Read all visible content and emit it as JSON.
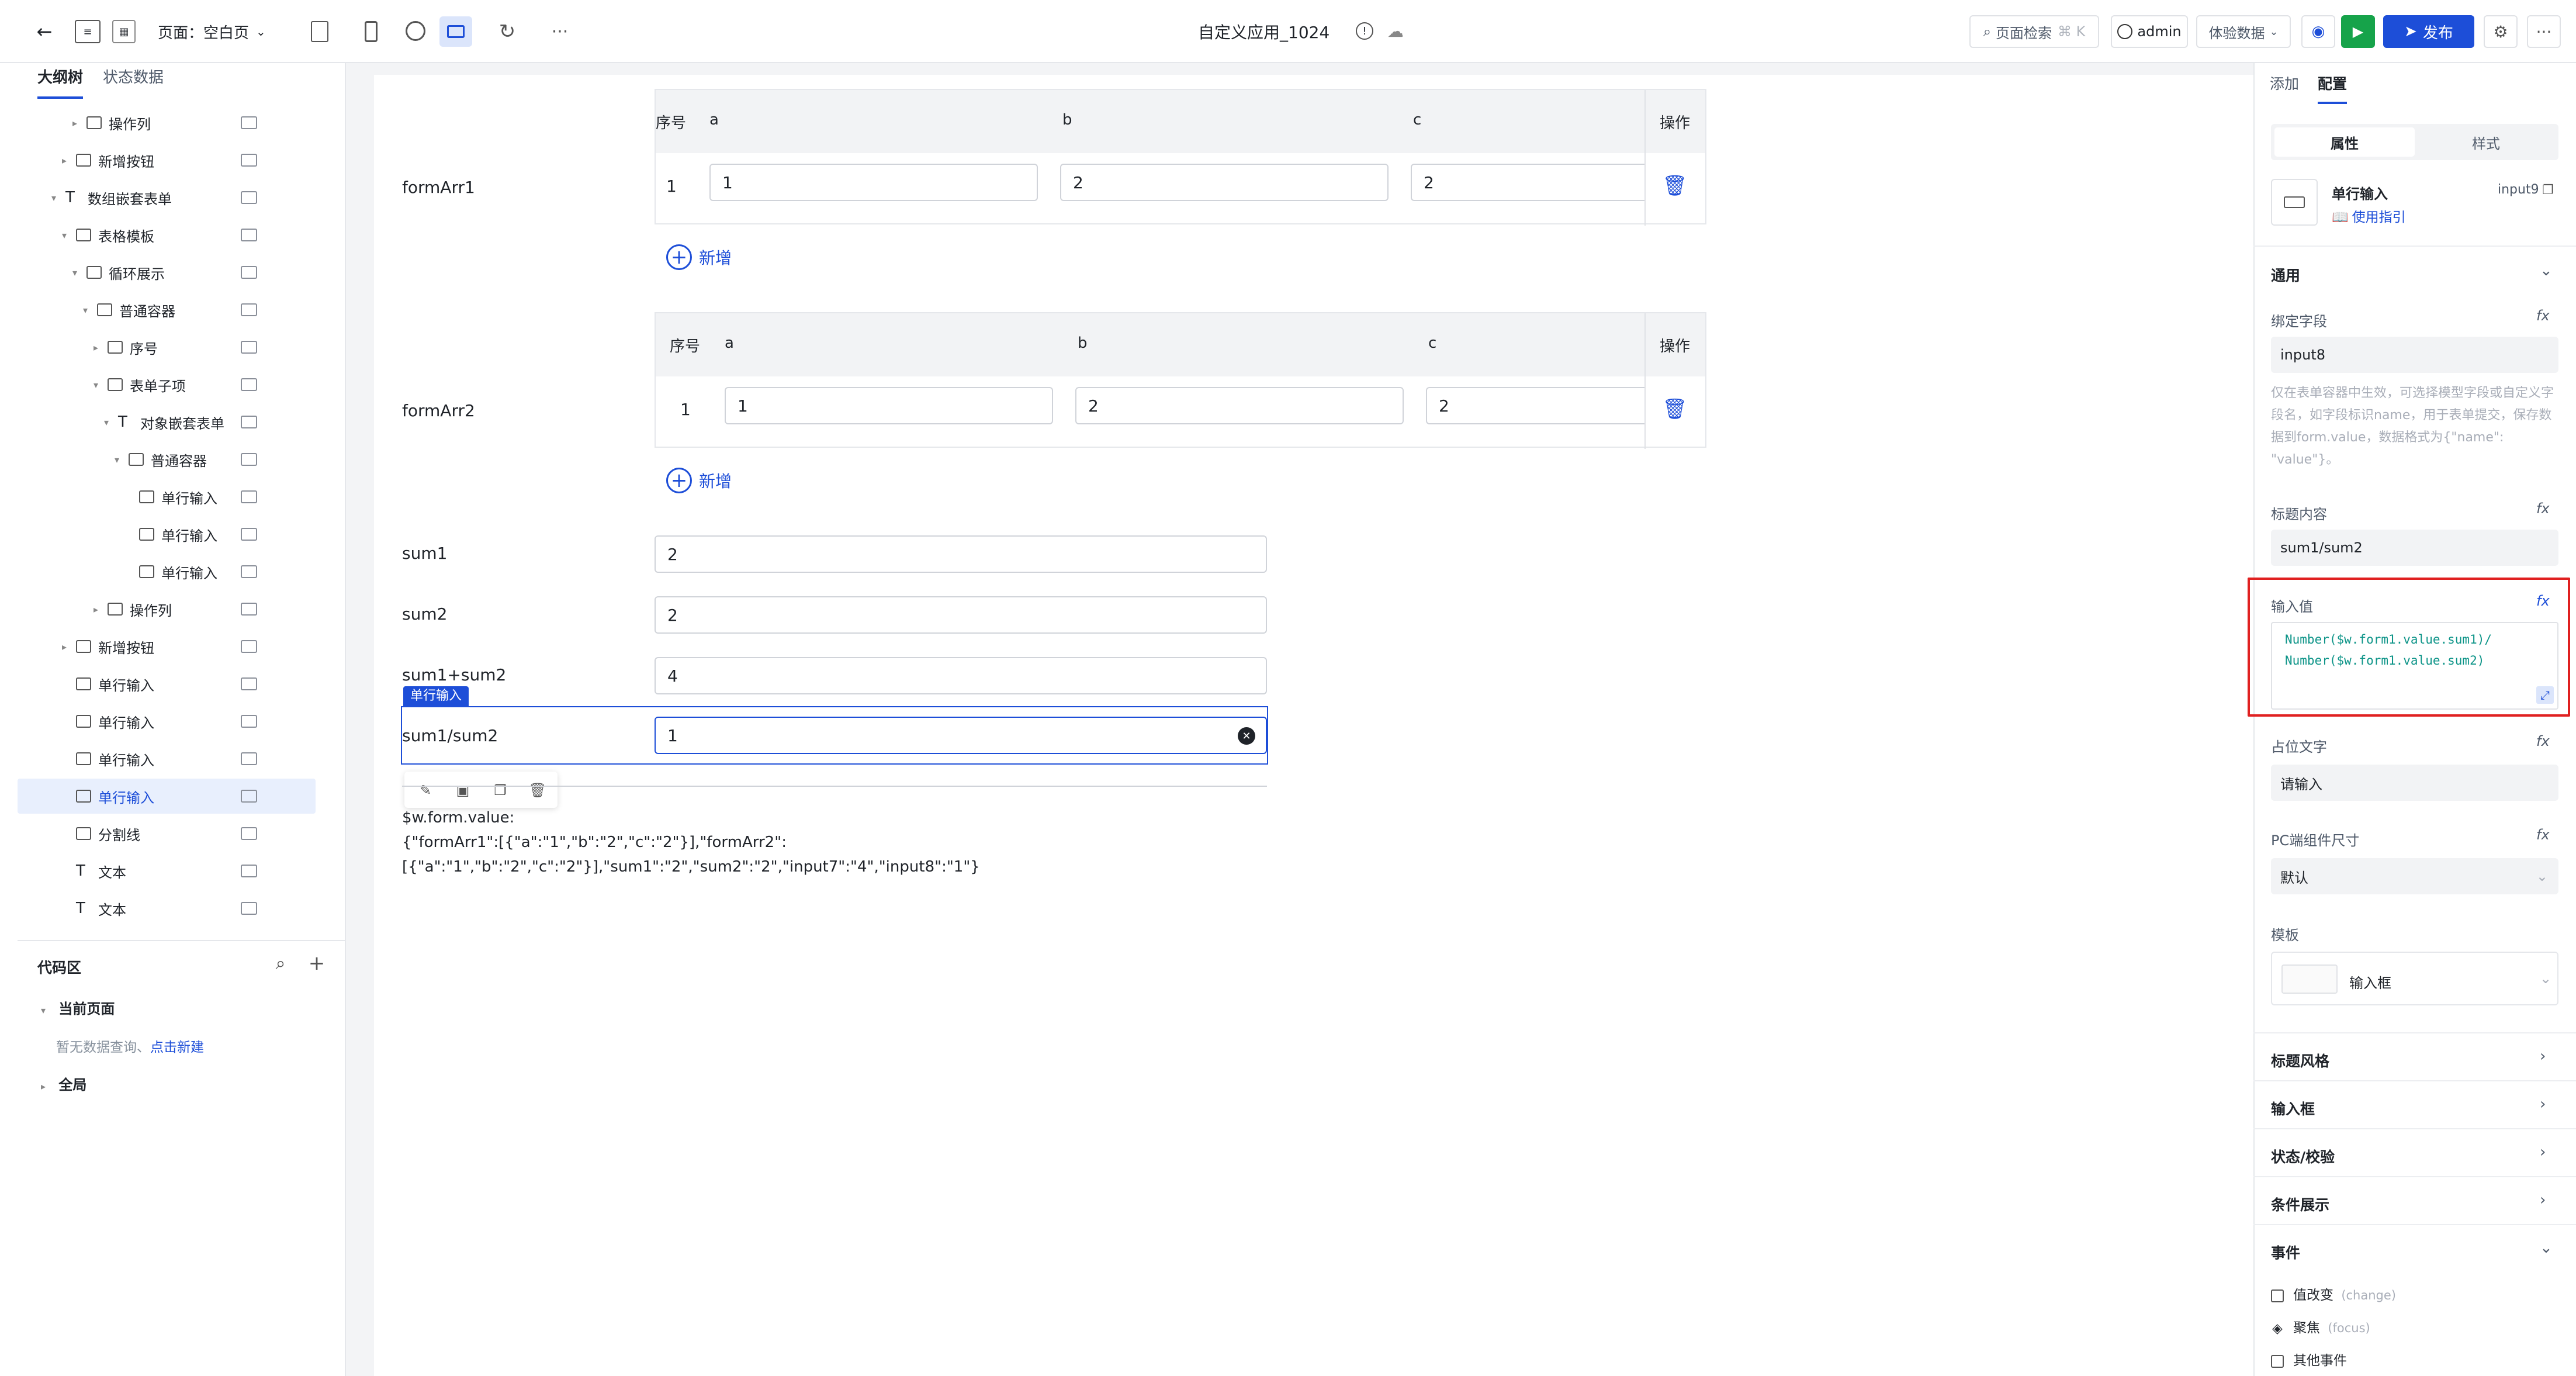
{
  "toolbar": {
    "page_label": "页面：空白页",
    "app_title": "自定义应用_1024",
    "search_label": "页面检索",
    "search_shortcut": "⌘ K",
    "user": "admin",
    "data_mode": "体验数据",
    "publish": "发布"
  },
  "left_tabs": [
    "大纲树",
    "状态数据"
  ],
  "tree": [
    {
      "label": "操作列",
      "indent": 3,
      "caret": "▸"
    },
    {
      "label": "新增按钮",
      "indent": 2,
      "caret": "▸"
    },
    {
      "label": "数组嵌套表单",
      "indent": 1,
      "caret": "▾",
      "type": "T"
    },
    {
      "label": "表格模板",
      "indent": 2,
      "caret": "▾"
    },
    {
      "label": "循环展示",
      "indent": 3,
      "caret": "▾"
    },
    {
      "label": "普通容器",
      "indent": 4,
      "caret": "▾"
    },
    {
      "label": "序号",
      "indent": 5,
      "caret": "▸"
    },
    {
      "label": "表单子项",
      "indent": 5,
      "caret": "▾"
    },
    {
      "label": "对象嵌套表单",
      "indent": 6,
      "caret": "▾",
      "type": "T"
    },
    {
      "label": "普通容器",
      "indent": 7,
      "caret": "▾"
    },
    {
      "label": "单行输入",
      "indent": 8,
      "caret": ""
    },
    {
      "label": "单行输入",
      "indent": 8,
      "caret": ""
    },
    {
      "label": "单行输入",
      "indent": 8,
      "caret": ""
    },
    {
      "label": "操作列",
      "indent": 5,
      "caret": "▸"
    },
    {
      "label": "新增按钮",
      "indent": 2,
      "caret": "▸"
    },
    {
      "label": "单行输入",
      "indent": 2,
      "caret": ""
    },
    {
      "label": "单行输入",
      "indent": 2,
      "caret": ""
    },
    {
      "label": "单行输入",
      "indent": 2,
      "caret": ""
    },
    {
      "label": "单行输入",
      "indent": 2,
      "caret": "",
      "selected": true
    },
    {
      "label": "分割线",
      "indent": 2,
      "caret": ""
    },
    {
      "label": "文本",
      "indent": 2,
      "caret": "",
      "type": "T"
    },
    {
      "label": "文本",
      "indent": 2,
      "caret": "",
      "type": "T"
    }
  ],
  "code_area": {
    "title": "代码区",
    "current_page": "当前页面",
    "empty_text": "暂无数据查询、",
    "create_link": "点击新建",
    "global": "全局"
  },
  "canvas": {
    "formArr1": {
      "label": "formArr1",
      "headers": [
        "序号",
        "a",
        "b",
        "c",
        "操作"
      ],
      "row": {
        "index": "1",
        "a": "1",
        "b": "2",
        "c": "2"
      },
      "add": "新增"
    },
    "formArr2": {
      "label": "formArr2",
      "headers": [
        "序号",
        "a",
        "b",
        "c",
        "操作"
      ],
      "row": {
        "index": "1",
        "a": "1",
        "b": "2",
        "c": "2"
      },
      "add": "新增"
    },
    "sum1": {
      "label": "sum1",
      "value": "2"
    },
    "sum2": {
      "label": "sum2",
      "value": "2"
    },
    "sum12": {
      "label": "sum1+sum2",
      "value": "4"
    },
    "selected_tag": "单行输入",
    "sumdiv": {
      "label": "sum1/sum2",
      "value": "1"
    },
    "output_line1": "$w.form.value:",
    "output_line2": "{\"formArr1\":[{\"a\":\"1\",\"b\":\"2\",\"c\":\"2\"}],\"formArr2\":",
    "output_line3": "[{\"a\":\"1\",\"b\":\"2\",\"c\":\"2\"}],\"sum1\":\"2\",\"sum2\":\"2\",\"input7\":\"4\",\"input8\":\"1\"}"
  },
  "right": {
    "tabs": [
      "添加",
      "配置"
    ],
    "seg": [
      "属性",
      "样式"
    ],
    "component_name": "单行输入",
    "component_id": "input9",
    "guide": "使用指引",
    "general": "通用",
    "bind_field_label": "绑定字段",
    "bind_field_value": "input8",
    "bind_help": "仅在表单容器中生效，可选择模型字段或自定义字段名，如字段标识name，用于表单提交，保存数据到form.value，数据格式为{\"name\": \"value\"}。",
    "title_label": "标题内容",
    "title_value": "sum1/sum2",
    "input_value_label": "输入值",
    "input_value_code1": "Number($w.form1.value.sum1)/",
    "input_value_code2": "Number($w.form1.value.sum2)",
    "placeholder_label": "占位文字",
    "placeholder_value": "请输入",
    "size_label": "PC端组件尺寸",
    "size_value": "默认",
    "template_label": "模板",
    "template_value": "输入框",
    "sections": [
      "标题风格",
      "输入框",
      "状态/校验",
      "条件展示"
    ],
    "events_title": "事件",
    "events": [
      {
        "name": "值改变",
        "code": "(change)"
      },
      {
        "name": "聚焦",
        "code": "(focus)"
      },
      {
        "name": "其他事件",
        "code": ""
      }
    ]
  }
}
